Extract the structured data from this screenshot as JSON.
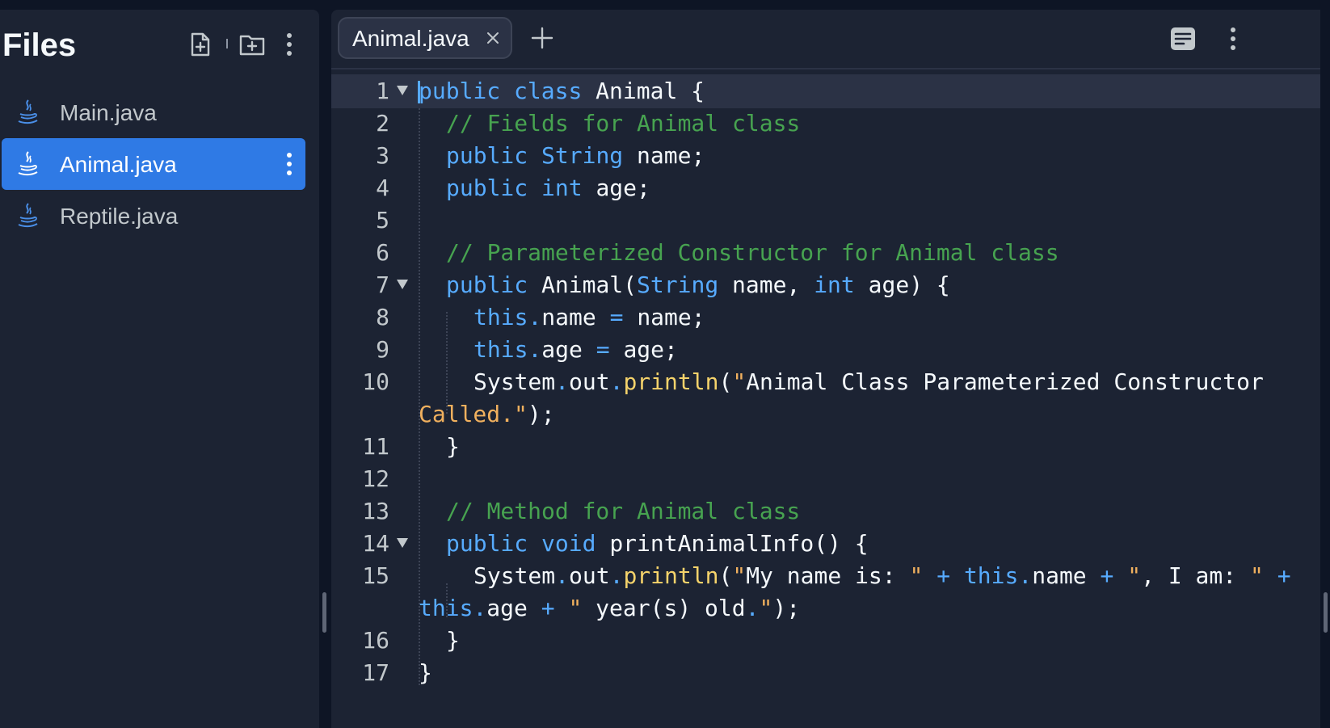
{
  "sidebar": {
    "title": "Files",
    "files": [
      {
        "name": "Main.java",
        "active": false
      },
      {
        "name": "Animal.java",
        "active": true
      },
      {
        "name": "Reptile.java",
        "active": false
      }
    ]
  },
  "editor": {
    "tab_label": "Animal.java",
    "lines": [
      {
        "n": "1",
        "text": "public class Animal {"
      },
      {
        "n": "2",
        "text": "// Fields for Animal class"
      },
      {
        "n": "3",
        "text": "public String name;"
      },
      {
        "n": "4",
        "text": "public int age;"
      },
      {
        "n": "5",
        "text": ""
      },
      {
        "n": "6",
        "text": "// Parameterized Constructor for Animal class"
      },
      {
        "n": "7",
        "text": "public Animal(String name, int age) {"
      },
      {
        "n": "8",
        "text": "this.name = name;"
      },
      {
        "n": "9",
        "text": "this.age = age;"
      },
      {
        "n": "10",
        "text": "System.out.println(\"Animal Class Parameterized Constructor"
      },
      {
        "n": "",
        "text": "Called.\");"
      },
      {
        "n": "11",
        "text": "}"
      },
      {
        "n": "12",
        "text": ""
      },
      {
        "n": "13",
        "text": "// Method for Animal class"
      },
      {
        "n": "14",
        "text": "public void printAnimalInfo() {"
      },
      {
        "n": "15",
        "text": "System.out.println(\"My name is: \" + this.name + \", I am: \" +"
      },
      {
        "n": "",
        "text": "this.age + \" year(s) old.\");"
      },
      {
        "n": "16",
        "text": "}"
      },
      {
        "n": "17",
        "text": "}"
      }
    ]
  },
  "colors": {
    "background": "#0e1525",
    "panel": "#1c2333",
    "active_file": "#2f7ae5",
    "keyword": "#57abff",
    "comment": "#47a350",
    "string": "#f0b05e",
    "function": "#f5d36b"
  },
  "icons": {
    "new_file": "file-plus-icon",
    "new_folder": "folder-plus-icon",
    "menu": "kebab-menu-icon",
    "java": "java-icon",
    "close": "close-icon",
    "add_tab": "plus-icon",
    "format": "format-code-icon"
  }
}
